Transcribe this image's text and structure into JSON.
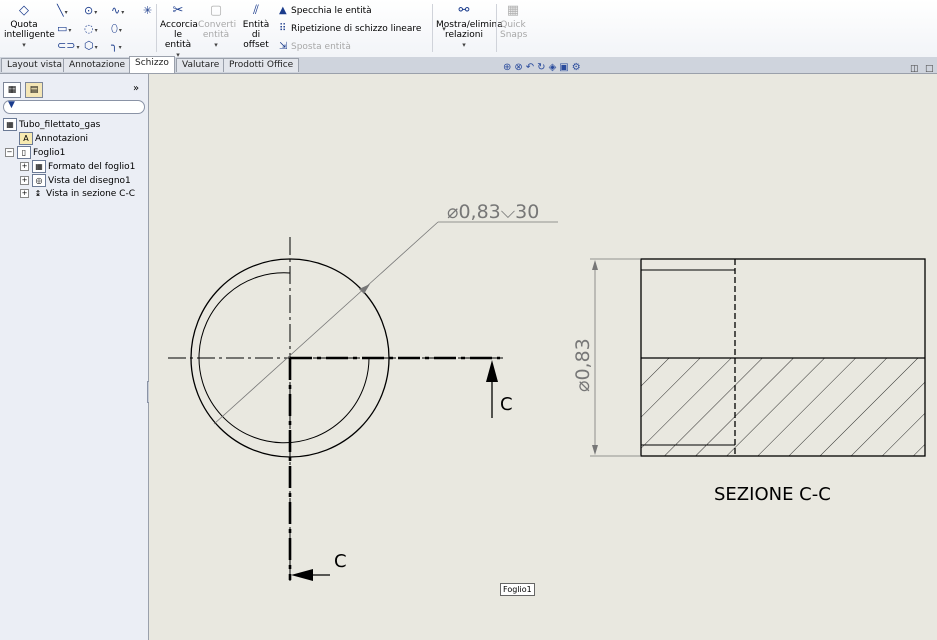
{
  "ribbon": {
    "smart_dim": "Quota intelligente",
    "trim": "Accorcia le entità",
    "convert": "Converti entità",
    "offset": "Entità di offset",
    "mirror": "Specchia le entità",
    "linear_pattern": "Ripetizione di schizzo lineare",
    "move": "Sposta entità",
    "relations": "Mostra/elimina relazioni",
    "quick_snaps": "Quick Snaps"
  },
  "tabs": [
    "Layout vista",
    "Annotazione",
    "Schizzo",
    "Valutare",
    "Prodotti Office"
  ],
  "tree": {
    "root": "Tubo_filettato_gas",
    "annotations": "Annotazioni",
    "sheet": "Foglio1",
    "sheet_format": "Formato del foglio1",
    "drawing_view": "Vista del disegno1",
    "section_view": "Vista in sezione C-C"
  },
  "drawing": {
    "hole_callout": "⌀0,83⌵30",
    "section_letter_1": "C",
    "section_letter_2": "C",
    "diameter_dim": "⌀0,83",
    "section_title": "SEZIONE C-C"
  },
  "sheet_tab": "Foglio1"
}
